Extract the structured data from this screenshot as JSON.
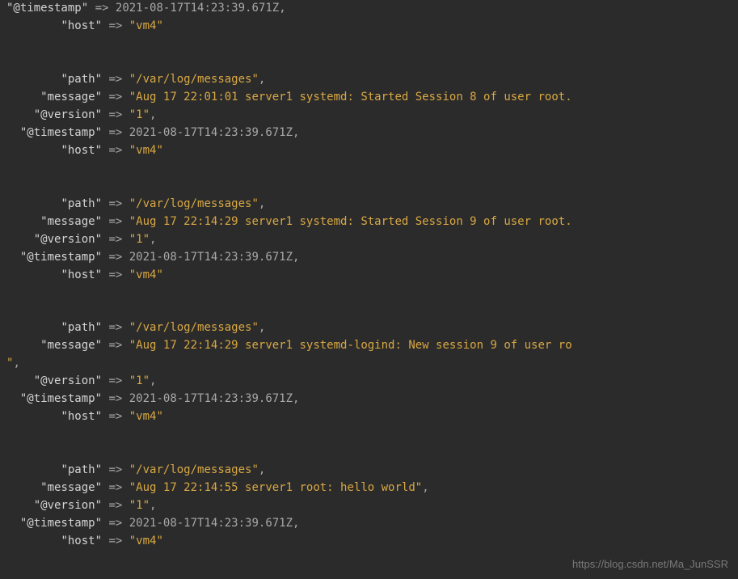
{
  "partial_first": {
    "timestamp_key": "\"@timestamp\"",
    "timestamp_val": "2021-08-17T14:23:39.671Z",
    "host_key": "\"host\"",
    "host_val": "\"vm4\""
  },
  "entries": [
    {
      "path_key": "\"path\"",
      "path_val": "\"/var/log/messages\"",
      "message_key": "\"message\"",
      "message_val": "\"Aug 17 22:01:01 server1 systemd: Started Session 8 of user root.",
      "message_wrap": "",
      "version_key": "\"@version\"",
      "version_val": "\"1\"",
      "timestamp_key": "\"@timestamp\"",
      "timestamp_val": "2021-08-17T14:23:39.671Z",
      "host_key": "\"host\"",
      "host_val": "\"vm4\""
    },
    {
      "path_key": "\"path\"",
      "path_val": "\"/var/log/messages\"",
      "message_key": "\"message\"",
      "message_val": "\"Aug 17 22:14:29 server1 systemd: Started Session 9 of user root.",
      "message_wrap": "",
      "version_key": "\"@version\"",
      "version_val": "\"1\"",
      "timestamp_key": "\"@timestamp\"",
      "timestamp_val": "2021-08-17T14:23:39.671Z",
      "host_key": "\"host\"",
      "host_val": "\"vm4\""
    },
    {
      "path_key": "\"path\"",
      "path_val": "\"/var/log/messages\"",
      "message_key": "\"message\"",
      "message_val": "\"Aug 17 22:14:29 server1 systemd-logind: New session 9 of user ro",
      "message_wrap": "\"",
      "version_key": "\"@version\"",
      "version_val": "\"1\"",
      "timestamp_key": "\"@timestamp\"",
      "timestamp_val": "2021-08-17T14:23:39.671Z",
      "host_key": "\"host\"",
      "host_val": "\"vm4\""
    },
    {
      "path_key": "\"path\"",
      "path_val": "\"/var/log/messages\"",
      "message_key": "\"message\"",
      "message_val": "\"Aug 17 22:14:55 server1 root: hello world\"",
      "message_wrap": "",
      "version_key": "\"@version\"",
      "version_val": "\"1\"",
      "timestamp_key": "\"@timestamp\"",
      "timestamp_val": "2021-08-17T14:23:39.671Z",
      "host_key": "\"host\"",
      "host_val": "\"vm4\""
    }
  ],
  "arrow": "=>",
  "watermark": "https://blog.csdn.net/Ma_JunSSR"
}
